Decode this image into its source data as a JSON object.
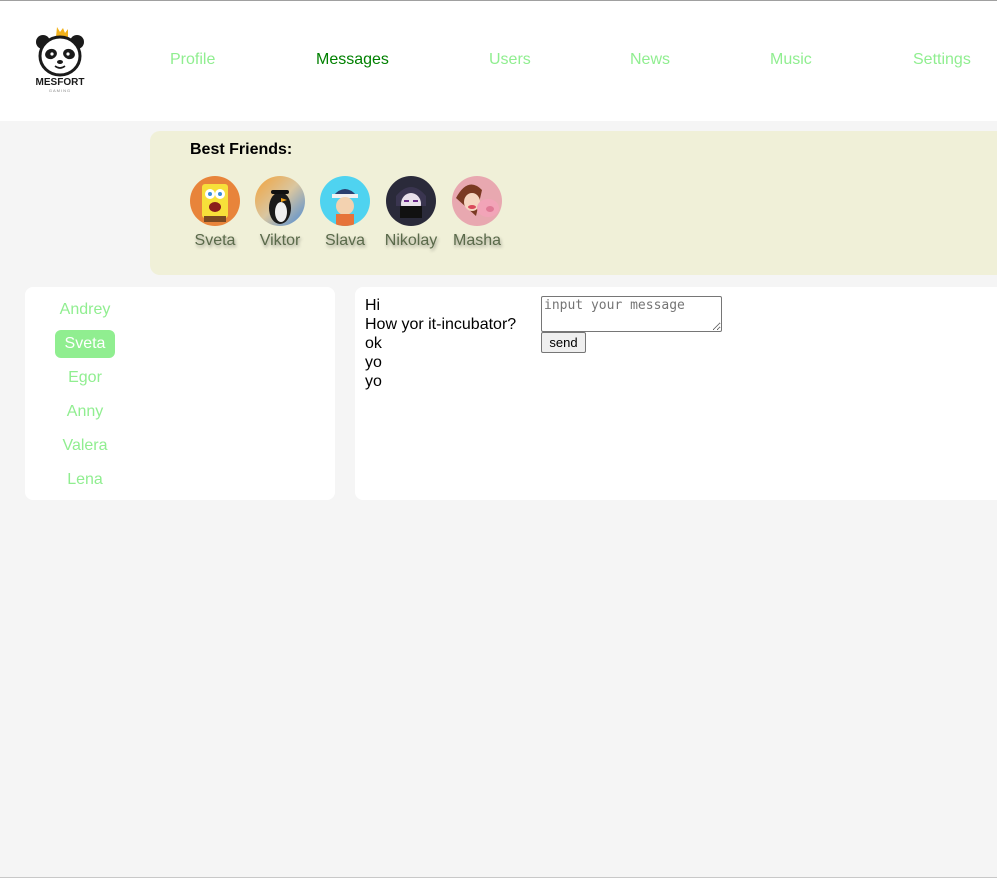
{
  "header": {
    "logo": {
      "text": "MESFORT",
      "subtext": "GAMING",
      "icon": "panda-crown-logo"
    },
    "nav": [
      {
        "label": "Profile",
        "active": false
      },
      {
        "label": "Messages",
        "active": true
      },
      {
        "label": "Users",
        "active": false
      },
      {
        "label": "News",
        "active": false
      },
      {
        "label": "Music",
        "active": false
      },
      {
        "label": "Settings",
        "active": false
      }
    ]
  },
  "friends": {
    "title": "Best Friends:",
    "items": [
      {
        "name": "Sveta",
        "avatar": "spongebob-avatar"
      },
      {
        "name": "Viktor",
        "avatar": "cartoon-penguin-avatar"
      },
      {
        "name": "Slava",
        "avatar": "dipper-avatar"
      },
      {
        "name": "Nikolay",
        "avatar": "anime-ninja-avatar"
      },
      {
        "name": "Masha",
        "avatar": "mabel-avatar"
      }
    ]
  },
  "dialogs": [
    {
      "name": "Andrey",
      "active": false
    },
    {
      "name": "Sveta",
      "active": true
    },
    {
      "name": "Egor",
      "active": false
    },
    {
      "name": "Anny",
      "active": false
    },
    {
      "name": "Valera",
      "active": false
    },
    {
      "name": "Lena",
      "active": false
    }
  ],
  "messages": {
    "items": [
      "Hi",
      "How yor it-incubator?",
      "ok",
      "yo",
      "yo"
    ],
    "input_placeholder": "input your message",
    "input_value": "",
    "send_label": "send"
  },
  "colors": {
    "nav_link": "#90ee90",
    "nav_active": "#008000",
    "friends_bg": "#f0f0d8",
    "page_bg": "#f5f5f5"
  }
}
